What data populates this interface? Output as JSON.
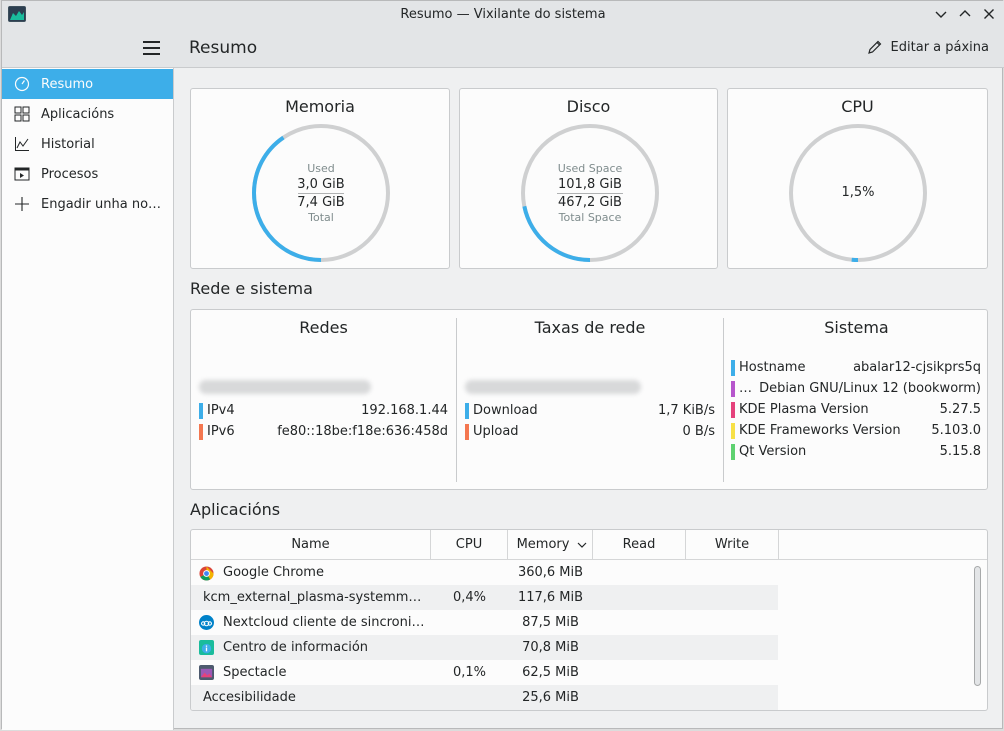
{
  "window": {
    "title": "Resumo — Vixilante do sistema"
  },
  "sidebar": {
    "items": [
      {
        "label": "Resumo",
        "icon": "speedometer-icon",
        "active": true
      },
      {
        "label": "Aplicacións",
        "icon": "grid-icon"
      },
      {
        "label": "Historial",
        "icon": "chart-icon"
      },
      {
        "label": "Procesos",
        "icon": "process-icon"
      },
      {
        "label": "Engadir unha no…",
        "icon": "plus-icon"
      }
    ]
  },
  "header": {
    "title": "Resumo",
    "edit_label": "Editar a páxina"
  },
  "gauges": {
    "memory": {
      "title": "Memoria",
      "top_label": "Used",
      "used": "3,0 GiB",
      "total": "7,4 GiB",
      "bottom_label": "Total",
      "fraction": 0.405
    },
    "disk": {
      "title": "Disco",
      "top_label": "Used Space",
      "used": "101,8 GiB",
      "total": "467,2 GiB",
      "bottom_label": "Total Space",
      "fraction": 0.218
    },
    "cpu": {
      "title": "CPU",
      "value": "1,5%",
      "fraction": 0.015
    }
  },
  "network_section": {
    "title": "Rede e sistema",
    "networks": {
      "title": "Redes",
      "rows": [
        {
          "key": "IPv4",
          "value": "192.168.1.44",
          "color": "#3daee9"
        },
        {
          "key": "IPv6",
          "value": "fe80::18be:f18e:636:458d",
          "color": "#f47750"
        }
      ]
    },
    "rates": {
      "title": "Taxas de rede",
      "rows": [
        {
          "key": "Download",
          "value": "1,7 KiB/s",
          "color": "#3daee9"
        },
        {
          "key": "Upload",
          "value": "0 B/s",
          "color": "#f47750"
        }
      ]
    },
    "system": {
      "title": "Sistema",
      "rows": [
        {
          "key": "Hostname",
          "value": "abalar12-cjsikprs5q",
          "color": "#3daee9"
        },
        {
          "key": "…",
          "value": "Debian GNU/Linux 12 (bookworm)",
          "color": "#b656cc"
        },
        {
          "key": "KDE Plasma Version",
          "value": "5.27.5",
          "color": "#e5427c"
        },
        {
          "key": "KDE Frameworks Version",
          "value": "5.103.0",
          "color": "#f7e046"
        },
        {
          "key": "Qt Version",
          "value": "5.15.8",
          "color": "#5ed170"
        }
      ]
    }
  },
  "applications": {
    "title": "Aplicacións",
    "columns": [
      "Name",
      "CPU",
      "Memory",
      "Read",
      "Write"
    ],
    "rows": [
      {
        "name": "Google Chrome",
        "cpu": "",
        "memory": "360,6 MiB",
        "icon": "chrome-icon"
      },
      {
        "name": "kcm_external_plasma-systemm…",
        "cpu": "0,4%",
        "memory": "117,6 MiB",
        "icon": ""
      },
      {
        "name": "Nextcloud cliente de sincroni…",
        "cpu": "",
        "memory": "87,5 MiB",
        "icon": "nextcloud-icon"
      },
      {
        "name": "Centro de información",
        "cpu": "",
        "memory": "70,8 MiB",
        "icon": "info-center-icon"
      },
      {
        "name": "Spectacle",
        "cpu": "0,1%",
        "memory": "62,5 MiB",
        "icon": "spectacle-icon"
      },
      {
        "name": "Accesibilidade",
        "cpu": "",
        "memory": "25,6 MiB",
        "icon": ""
      }
    ]
  },
  "colors": {
    "accent": "#3daee9",
    "track": "#cfd0d1"
  }
}
